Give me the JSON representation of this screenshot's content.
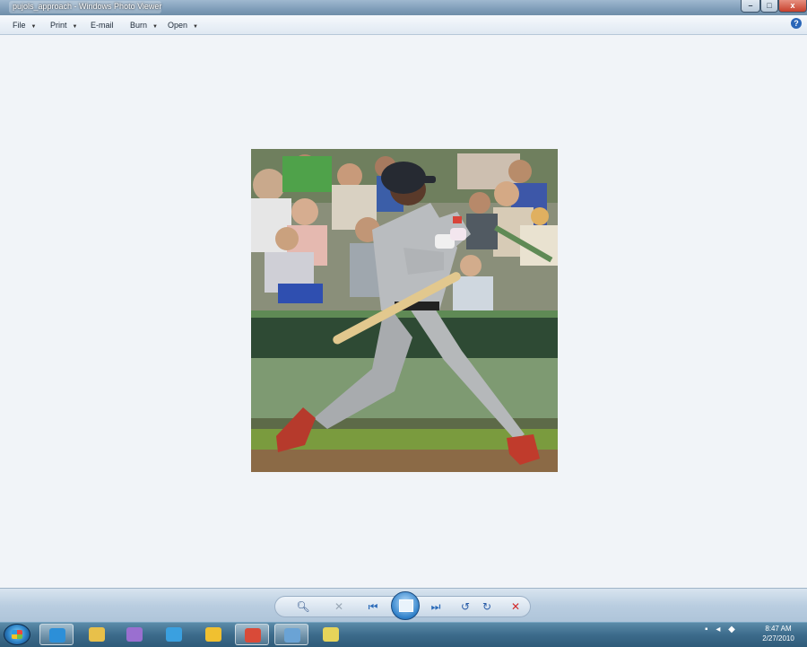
{
  "window": {
    "title": "pujols_approach - Windows Photo Viewer",
    "controls": {
      "minimize": "–",
      "maximize": "□",
      "close": "x"
    }
  },
  "menu": {
    "items": [
      {
        "label": "File",
        "has_dropdown": true
      },
      {
        "label": "Print",
        "has_dropdown": true
      },
      {
        "label": "E-mail",
        "has_dropdown": false
      },
      {
        "label": "Burn",
        "has_dropdown": true
      },
      {
        "label": "Open",
        "has_dropdown": true
      }
    ],
    "dropdown_glyph": "▼",
    "help_label": "?"
  },
  "viewer": {
    "photo_subject": "baseball batter swinging bat"
  },
  "controls": {
    "zoom": "🔍︎",
    "fit": "✕",
    "previous": "⏮",
    "play_slideshow": "",
    "next": "⏭",
    "rotate_left": "↺",
    "rotate_right": "↻",
    "delete": "✕"
  },
  "taskbar": {
    "items": [
      {
        "name": "internet-explorer-icon",
        "color": "#2c8fd8",
        "active": true
      },
      {
        "name": "folder-icon",
        "color": "#e8c04a",
        "active": false
      },
      {
        "name": "media-app-icon",
        "color": "#9a6fd0",
        "active": false
      },
      {
        "name": "people-app-icon",
        "color": "#3aa0e0",
        "active": false
      },
      {
        "name": "media-center-icon",
        "color": "#f0c030",
        "active": false
      },
      {
        "name": "chrome-icon",
        "color": "#d94a38",
        "active": true
      },
      {
        "name": "photo-viewer-icon",
        "color": "#6aa3d5",
        "active": true
      },
      {
        "name": "notes-icon",
        "color": "#e6d45a",
        "active": false
      }
    ],
    "clock_time": "8:47 AM",
    "clock_date": "2/27/2010"
  }
}
